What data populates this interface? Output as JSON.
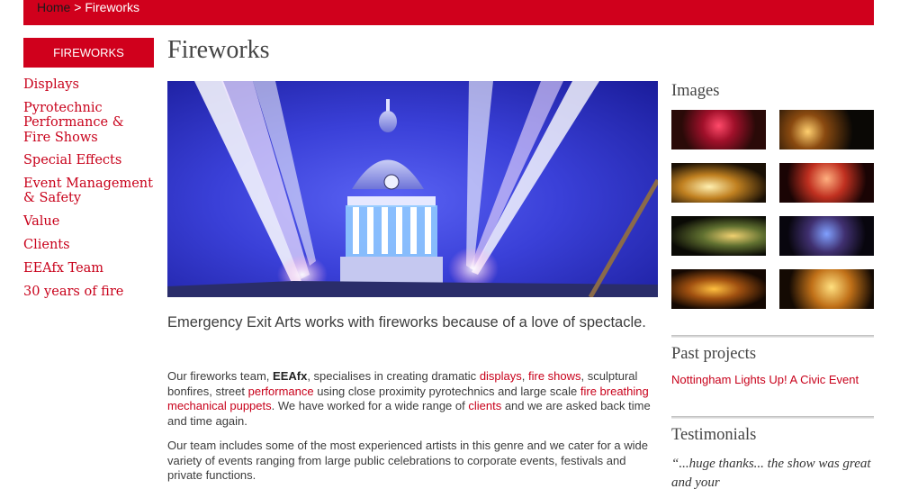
{
  "breadcrumb": {
    "home": "Home",
    "separator": " > ",
    "current": "Fireworks"
  },
  "sidebar": {
    "heading": "FIREWORKS",
    "items": [
      {
        "label": "Displays"
      },
      {
        "label": "Pyrotechnic Performance & Fire Shows"
      },
      {
        "label": "Special Effects"
      },
      {
        "label": "Event Management & Safety"
      },
      {
        "label": "Value"
      },
      {
        "label": "Clients"
      },
      {
        "label": "EEAfx Team"
      },
      {
        "label": "30 years of fire"
      }
    ]
  },
  "main": {
    "title": "Fireworks",
    "lead": "Emergency Exit Arts works with fireworks because of a love of spectacle.",
    "p1": {
      "t1": "Our fireworks team, ",
      "brand": "EEAfx",
      "t2": ", specialises in creating dramatic ",
      "link_displays": "displays",
      "t3": ", ",
      "link_fire_shows": "fire shows",
      "t4": ", sculptural bonfires, street ",
      "link_performance": "performance",
      "t5": " using close proximity pyrotechnics and large scale ",
      "link_puppets": "fire breathing mechanical puppets",
      "t6": ". We have worked for a wide range of ",
      "link_clients": "clients",
      "t7": " and we are asked back time and time again."
    },
    "p2": "Our team includes some of the most experienced artists in this genre and we cater for a wide variety of events ranging from large public celebrations to corporate events, festivals and private functions."
  },
  "right": {
    "images_title": "Images",
    "past_title": "Past projects",
    "past_link": "Nottingham Lights Up! A Civic Event",
    "testimonials_title": "Testimonials",
    "quote": "“...huge thanks... the show was great and your"
  },
  "colors": {
    "brand_red": "#d0001c",
    "link_red": "#c8001a",
    "hero_blue": "#3a40d8"
  }
}
